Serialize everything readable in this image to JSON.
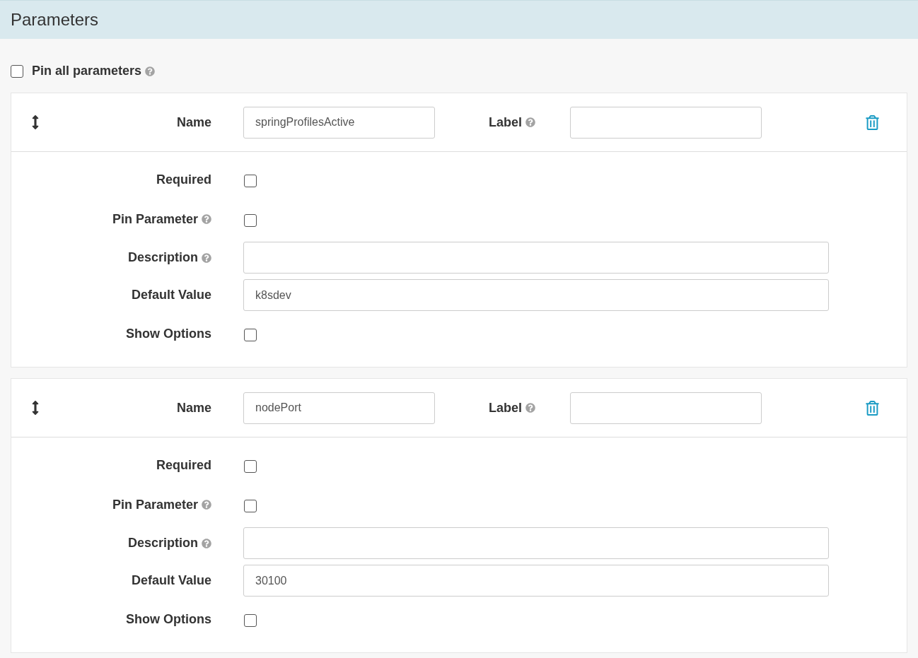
{
  "header": {
    "title": "Parameters"
  },
  "pin_all": {
    "label": "Pin all parameters",
    "checked": false,
    "help": true
  },
  "parameters": [
    {
      "name_label": "Name",
      "name_value": "springProfilesActive",
      "label_label": "Label",
      "label_help": true,
      "fields": [
        {
          "kind": "checkbox",
          "label": "Required",
          "help": false,
          "checked": false
        },
        {
          "kind": "checkbox",
          "label": "Pin Parameter",
          "help": true,
          "checked": false
        },
        {
          "kind": "input",
          "label": "Description",
          "help": true
        },
        {
          "kind": "input",
          "label": "Default Value",
          "help": false,
          "value": "k8sdev"
        },
        {
          "kind": "checkbox",
          "label": "Show Options",
          "help": false,
          "checked": false
        }
      ]
    },
    {
      "name_label": "Name",
      "name_value": "nodePort",
      "label_label": "Label",
      "label_help": true,
      "fields": [
        {
          "kind": "checkbox",
          "label": "Required",
          "help": false,
          "checked": false
        },
        {
          "kind": "checkbox",
          "label": "Pin Parameter",
          "help": true,
          "checked": false
        },
        {
          "kind": "input",
          "label": "Description",
          "help": true
        },
        {
          "kind": "input",
          "label": "Default Value",
          "help": false,
          "value": "30100"
        },
        {
          "kind": "checkbox",
          "label": "Show Options",
          "help": false,
          "checked": false
        }
      ]
    }
  ]
}
